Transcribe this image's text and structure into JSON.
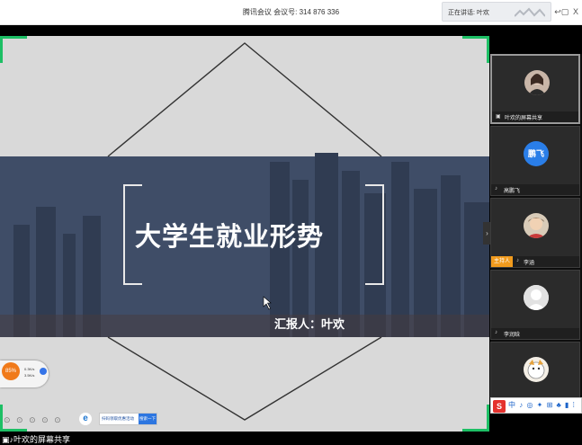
{
  "window": {
    "meeting_title": "腾讯会议 会议号: 314 876 336",
    "speaking_label": "正在讲话: 叶欢",
    "minimize_icon": "minimize-icon",
    "close_label": "X"
  },
  "slide": {
    "title": "大学生就业形势",
    "presenter": "汇报人：叶欢"
  },
  "network": {
    "percent": "85%",
    "up_speed": "0.3K/s",
    "down_speed": "3.5K/s"
  },
  "ad": {
    "text": "扫码领取优惠活动",
    "button": "搜索一下"
  },
  "participants": [
    {
      "name": "叶欢的屏幕共享",
      "avatar_text": ""
    },
    {
      "name": "高鹏飞",
      "avatar_text": "鹏飞"
    },
    {
      "name": "李涵",
      "avatar_text": "",
      "host_label": "主持人"
    },
    {
      "name": "李润晗",
      "avatar_text": ""
    },
    {
      "name": "",
      "avatar_text": ""
    }
  ],
  "ime": {
    "logo": "S",
    "items": "中 ♪ ◎ ✦ ⊞ ♣ ▮ ⁞"
  },
  "status": {
    "text": "叶欢的屏幕共享"
  },
  "colors": {
    "accent_green": "#1dbf65",
    "host_orange": "#f29b1d",
    "banner_navy": "#3f4d67"
  }
}
